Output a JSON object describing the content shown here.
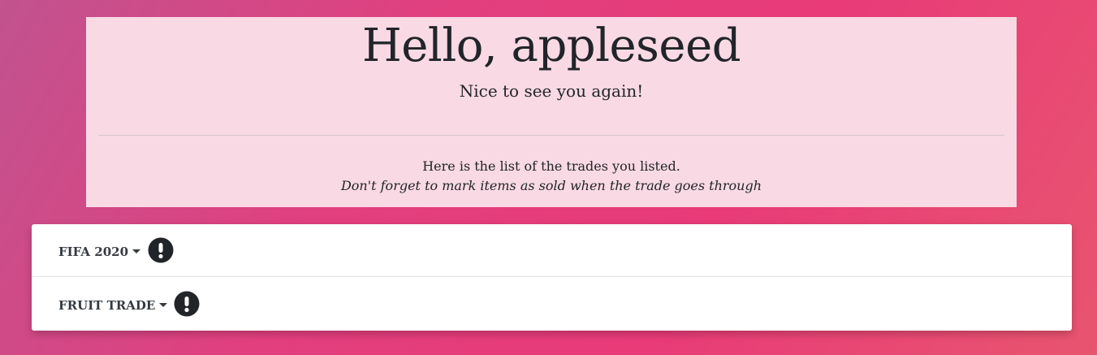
{
  "hero": {
    "title": "Hello, appleseed",
    "subtitle": "Nice to see you again!",
    "info": "Here is the list of the trades you listed.",
    "note": "Don't forget to mark items as sold when the trade goes through"
  },
  "trades": [
    {
      "name": "FIFA 2020",
      "icon": "exclamation-circle-icon"
    },
    {
      "name": "FRUIT TRADE",
      "icon": "exclamation-circle-icon"
    }
  ],
  "colors": {
    "background_gradient": [
      "#c1538f",
      "#e23f7e",
      "#e8556f"
    ],
    "hero_background": "#f9d9e3",
    "card_background": "#ffffff",
    "icon": "#212529"
  }
}
